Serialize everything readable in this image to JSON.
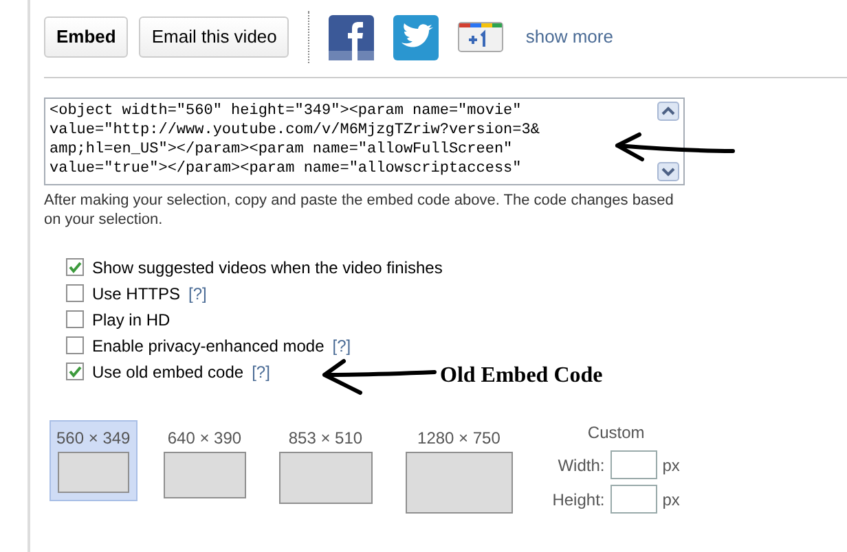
{
  "actions": [
    {
      "label": "Embed",
      "selected": true
    },
    {
      "label": "Email this video",
      "selected": false
    }
  ],
  "share": {
    "show_more": "show more"
  },
  "embed_code": [
    "<object width=\"560\" height=\"349\"><param name=\"movie\"",
    "value=\"http://www.youtube.com/v/M6MjzgTZriw?version=3&",
    "amp;hl=en_US\"></param><param name=\"allowFullScreen\"",
    "value=\"true\"></param><param name=\"allowscriptaccess\""
  ],
  "hint": "After making your selection, copy and paste the embed code above. The code changes based on your selection.",
  "options": [
    {
      "label": "Show suggested videos when the video finishes",
      "checked": true
    },
    {
      "label": "Use HTTPS",
      "help": "[?]",
      "checked": false
    },
    {
      "label": "Play in HD",
      "checked": false
    },
    {
      "label": "Enable privacy-enhanced mode",
      "help": "[?]",
      "checked": false
    },
    {
      "label": "Use old embed code",
      "help": "[?]",
      "checked": true
    }
  ],
  "annotation": "Old Embed Code",
  "sizes": [
    {
      "label": "560 × 349",
      "selected": true
    },
    {
      "label": "640 × 390",
      "selected": false
    },
    {
      "label": "853 × 510",
      "selected": false
    },
    {
      "label": "1280 × 750",
      "selected": false
    }
  ],
  "custom": {
    "title": "Custom",
    "fields": [
      {
        "label": "Width:",
        "unit": "px"
      },
      {
        "label": "Height:",
        "unit": "px"
      }
    ]
  }
}
